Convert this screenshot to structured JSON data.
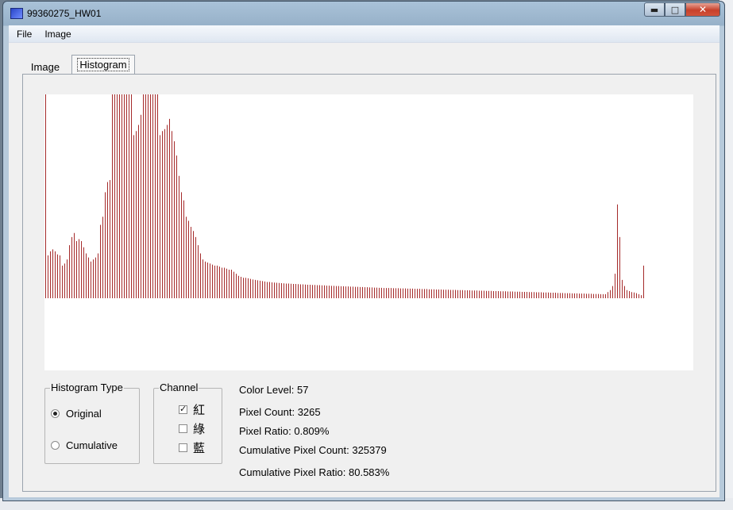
{
  "window": {
    "title": "99360275_HW01",
    "controls": {
      "minimize": "▬",
      "maximize": "□",
      "close": "✕"
    }
  },
  "menu": [
    "File",
    "Image"
  ],
  "tabs": [
    {
      "label": "Image",
      "active": false
    },
    {
      "label": "Histogram",
      "active": true
    }
  ],
  "histogram": {
    "bar_color": "#a52a2a",
    "ymax": 1000,
    "values": [
      1000,
      210,
      230,
      240,
      230,
      215,
      210,
      160,
      170,
      190,
      260,
      300,
      320,
      280,
      290,
      280,
      250,
      220,
      200,
      180,
      190,
      200,
      220,
      360,
      400,
      520,
      570,
      580,
      1000,
      1000,
      1000,
      1000,
      1000,
      1000,
      1000,
      1000,
      1000,
      800,
      820,
      850,
      900,
      1000,
      1000,
      1000,
      1000,
      1000,
      1000,
      1000,
      800,
      820,
      830,
      850,
      880,
      820,
      770,
      700,
      600,
      520,
      480,
      400,
      380,
      350,
      330,
      300,
      260,
      220,
      190,
      180,
      175,
      170,
      165,
      160,
      160,
      155,
      150,
      150,
      145,
      140,
      140,
      130,
      120,
      110,
      105,
      100,
      100,
      98,
      95,
      92,
      90,
      88,
      86,
      84,
      82,
      80,
      80,
      78,
      77,
      76,
      75,
      74,
      73,
      72,
      72,
      71,
      70,
      70,
      69,
      68,
      68,
      67,
      66,
      66,
      65,
      65,
      64,
      64,
      63,
      63,
      62,
      62,
      61,
      61,
      60,
      60,
      59,
      59,
      58,
      58,
      57,
      57,
      56,
      56,
      55,
      55,
      54,
      54,
      53,
      53,
      52,
      52,
      51,
      51,
      50,
      50,
      50,
      50,
      49,
      49,
      49,
      48,
      48,
      48,
      47,
      47,
      47,
      46,
      46,
      46,
      45,
      45,
      45,
      44,
      44,
      44,
      43,
      43,
      43,
      42,
      42,
      42,
      41,
      41,
      41,
      40,
      40,
      40,
      39,
      39,
      39,
      38,
      38,
      38,
      37,
      37,
      37,
      36,
      36,
      36,
      35,
      35,
      35,
      34,
      34,
      34,
      33,
      33,
      33,
      32,
      32,
      32,
      31,
      31,
      31,
      30,
      30,
      30,
      29,
      29,
      29,
      28,
      28,
      28,
      27,
      27,
      27,
      26,
      26,
      26,
      25,
      25,
      25,
      24,
      24,
      24,
      23,
      23,
      23,
      22,
      22,
      22,
      21,
      21,
      21,
      20,
      20,
      20,
      30,
      40,
      60,
      120,
      460,
      300,
      90,
      60,
      40,
      35,
      30,
      28,
      25,
      20,
      15,
      160
    ]
  },
  "histogram_type": {
    "title": "Histogram Type",
    "options": [
      {
        "label": "Original",
        "selected": true
      },
      {
        "label": "Cumulative",
        "selected": false
      }
    ]
  },
  "channel": {
    "title": "Channel",
    "options": [
      {
        "label": "紅",
        "checked": true
      },
      {
        "label": "綠",
        "checked": false
      },
      {
        "label": "藍",
        "checked": false
      }
    ]
  },
  "info": {
    "color_level": "Color Level: 57",
    "pixel_count": "Pixel Count: 3265",
    "pixel_ratio": "Pixel Ratio: 0.809%",
    "cumulative_count": "Cumulative Pixel Count: 325379",
    "cumulative_ratio": "Cumulative Pixel Ratio: 80.583%"
  }
}
